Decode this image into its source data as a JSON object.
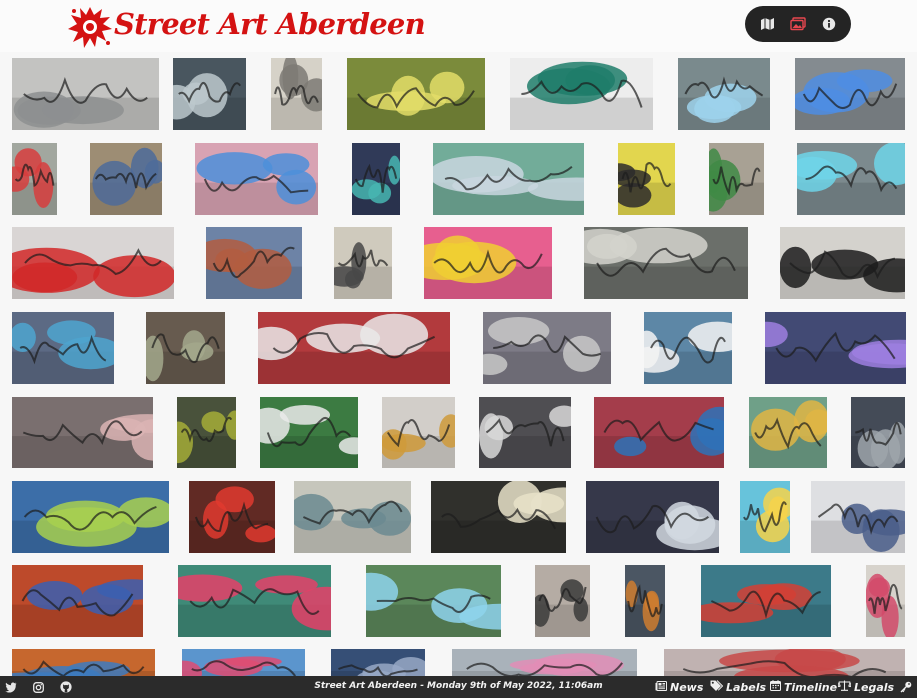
{
  "header": {
    "site_title": "Street Art Aberdeen",
    "icons": [
      "map-icon",
      "gallery-icon",
      "info-icon"
    ]
  },
  "gallery": {
    "photo_count": 57,
    "photos": [
      {
        "primary": "#c3c3c1",
        "accent": "#8d8f90"
      },
      {
        "primary": "#49565f",
        "accent": "#bcc8cd"
      },
      {
        "primary": "#d6d2c8",
        "accent": "#7d7a74"
      },
      {
        "primary": "#7b8b3b",
        "accent": "#e3dd69"
      },
      {
        "primary": "#ededed",
        "accent": "#1f7d6a"
      },
      {
        "primary": "#7a8a8d",
        "accent": "#9ed2ec"
      },
      {
        "primary": "#848b90",
        "accent": "#4d8de4"
      },
      {
        "primary": "#a2a79f",
        "accent": "#d73d3d"
      },
      {
        "primary": "#9d8d74",
        "accent": "#4e6b9a"
      },
      {
        "primary": "#d8a3b3",
        "accent": "#4d8fd9"
      },
      {
        "primary": "#303a58",
        "accent": "#47b6b2"
      },
      {
        "primary": "#72ac99",
        "accent": "#c9d6df"
      },
      {
        "primary": "#e2d64e",
        "accent": "#2d2b2c"
      },
      {
        "primary": "#a8a194",
        "accent": "#3f8a45"
      },
      {
        "primary": "#7c8a8e",
        "accent": "#6ed5e9"
      },
      {
        "primary": "#d9d5d4",
        "accent": "#d12828"
      },
      {
        "primary": "#6d83a6",
        "accent": "#b35d3f"
      },
      {
        "primary": "#cfcabd",
        "accent": "#484848"
      },
      {
        "primary": "#e75f8f",
        "accent": "#f0cf33"
      },
      {
        "primary": "#6b6f6a",
        "accent": "#d3d4cd"
      },
      {
        "primary": "#d4d2cd",
        "accent": "#1c1c1c"
      },
      {
        "primary": "#5c6a84",
        "accent": "#4ea4cf"
      },
      {
        "primary": "#675b4f",
        "accent": "#a3a88c"
      },
      {
        "primary": "#b23a3d",
        "accent": "#e9e9e9"
      },
      {
        "primary": "#7d7b86",
        "accent": "#c8c8c8"
      },
      {
        "primary": "#5d87a6",
        "accent": "#f3f3f3"
      },
      {
        "primary": "#424a74",
        "accent": "#9e7fe0"
      },
      {
        "primary": "#7a6f6f",
        "accent": "#dab4b4"
      },
      {
        "primary": "#49523b",
        "accent": "#a4ad38"
      },
      {
        "primary": "#3c7b42",
        "accent": "#eaeaea"
      },
      {
        "primary": "#d2cec9",
        "accent": "#cf9a3a"
      },
      {
        "primary": "#4f4e52",
        "accent": "#d8d8d8"
      },
      {
        "primary": "#a43d4b",
        "accent": "#2e72b8"
      },
      {
        "primary": "#6fa088",
        "accent": "#e0b544"
      },
      {
        "primary": "#444b57",
        "accent": "#9fa6ac"
      },
      {
        "primary": "#3c6ea8",
        "accent": "#a8d04f"
      },
      {
        "primary": "#612a24",
        "accent": "#e03a2f"
      },
      {
        "primary": "#c6c6bc",
        "accent": "#6b8a90"
      },
      {
        "primary": "#30302c",
        "accent": "#e7e2c9"
      },
      {
        "primary": "#36384a",
        "accent": "#d1d8e1"
      },
      {
        "primary": "#67c3db",
        "accent": "#f6d34b"
      },
      {
        "primary": "#dedfe2",
        "accent": "#4a5e8a"
      },
      {
        "primary": "#bd4a2b",
        "accent": "#3b5fb1"
      },
      {
        "primary": "#3f8a78",
        "accent": "#e54068"
      },
      {
        "primary": "#5b875a",
        "accent": "#8ed3ec"
      },
      {
        "primary": "#b5aca4",
        "accent": "#3b3b3b"
      },
      {
        "primary": "#4b5663",
        "accent": "#cf7c2f"
      },
      {
        "primary": "#3c7a89",
        "accent": "#d33f35"
      },
      {
        "primary": "#d7d3cc",
        "accent": "#d24a6a"
      },
      {
        "primary": "#c6672e",
        "accent": "#3c7bc0"
      },
      {
        "primary": "#5b95cd",
        "accent": "#df4c72"
      },
      {
        "primary": "#364f76",
        "accent": "#98a8c5"
      },
      {
        "primary": "#a9b2ba",
        "accent": "#e28db6"
      },
      {
        "primary": "#c0b2b1",
        "accent": "#c74848"
      },
      {
        "primary": "#ded7dc",
        "accent": "#2c2c2c"
      },
      {
        "primary": "#3f3f3f",
        "accent": "#e7e7e7"
      },
      {
        "primary": "#e8e3da",
        "accent": "#c91f1f"
      }
    ]
  },
  "footer": {
    "social_icons": [
      "twitter-icon",
      "instagram-icon",
      "github-icon"
    ],
    "center_text": "Street Art Aberdeen - Monday 9th of May 2022, 11:06am",
    "links": [
      {
        "label": "News",
        "icon": "newspaper-icon"
      },
      {
        "label": "Labels",
        "icon": "tags-icon"
      },
      {
        "label": "Timeline",
        "icon": "calendar-icon"
      },
      {
        "label": "Legals",
        "icon": "scales-icon"
      }
    ],
    "end_icon": "key-icon"
  }
}
